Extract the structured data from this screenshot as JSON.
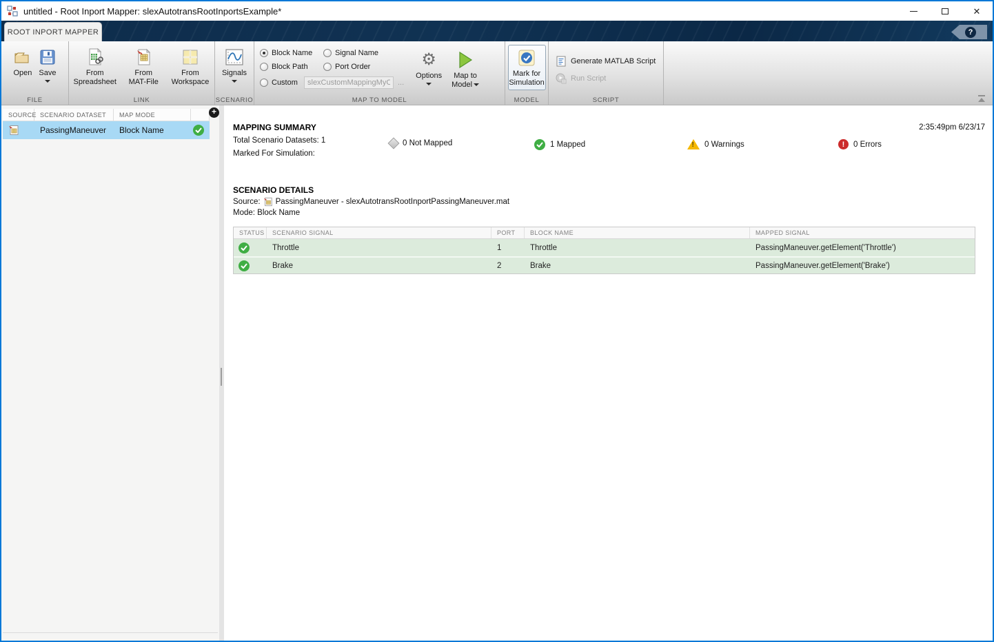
{
  "window": {
    "title": "untitled - Root Inport Mapper: slexAutotransRootInportsExample*"
  },
  "tab": {
    "label": "ROOT INPORT MAPPER",
    "help_icon": "question-mark"
  },
  "ribbon": {
    "file": {
      "label": "FILE",
      "open": "Open",
      "save": "Save"
    },
    "link": {
      "label": "LINK",
      "from_spreadsheet": "From Spreadsheet",
      "from_mat_file": "From MAT-File",
      "from_workspace": "From Workspace"
    },
    "scenario": {
      "label": "SCENARIO",
      "signals": "Signals"
    },
    "map": {
      "label": "MAP TO MODEL",
      "block_name": "Block Name",
      "signal_name": "Signal Name",
      "block_path": "Block Path",
      "port_order": "Port Order",
      "custom": "Custom",
      "custom_value": "slexCustomMappingMyCusto",
      "ellipsis": "...",
      "options": "Options",
      "map_line1": "Map to",
      "map_line2": "Model",
      "selected_mode": "Block Name"
    },
    "model": {
      "label": "MODEL",
      "mark_line1": "Mark for",
      "mark_line2": "Simulation"
    },
    "script": {
      "label": "SCRIPT",
      "generate": "Generate MATLAB Script",
      "run": "Run Script"
    }
  },
  "left_panel": {
    "columns": {
      "source": "SOURCE",
      "dataset": "SCENARIO DATASET",
      "map_mode": "MAP MODE"
    },
    "row": {
      "dataset": "PassingManeuver",
      "map_mode": "Block Name",
      "status": "mapped"
    }
  },
  "summary": {
    "title": "MAPPING SUMMARY",
    "timestamp": "2:35:49pm 6/23/17",
    "total_datasets": "Total Scenario Datasets: 1",
    "marked": "Marked For Simulation:",
    "not_mapped": "0 Not Mapped",
    "mapped": "1 Mapped",
    "warnings": "0 Warnings",
    "errors": "0 Errors"
  },
  "details": {
    "title": "SCENARIO DETAILS",
    "source_label": "Source:",
    "source_value": "PassingManeuver - slexAutotransRootInportPassingManeuver.mat",
    "mode_line": "Mode: Block Name",
    "table": {
      "columns": [
        "STATUS",
        "SCENARIO SIGNAL",
        "PORT",
        "BLOCK NAME",
        "MAPPED SIGNAL"
      ],
      "rows": [
        {
          "status": "mapped",
          "signal": "Throttle",
          "port": "1",
          "block": "Throttle",
          "mapped": "PassingManeuver.getElement('Throttle')"
        },
        {
          "status": "mapped",
          "signal": "Brake",
          "port": "2",
          "block": "Brake",
          "mapped": "PassingManeuver.getElement('Brake')"
        }
      ]
    }
  },
  "colors": {
    "accent_blue": "#0078d7",
    "selection_blue": "#a8d9f5",
    "mapped_green": "#3fae44",
    "warning_yellow": "#f5b800",
    "error_red": "#cc2b2b",
    "row_green": "#dcebdc"
  }
}
